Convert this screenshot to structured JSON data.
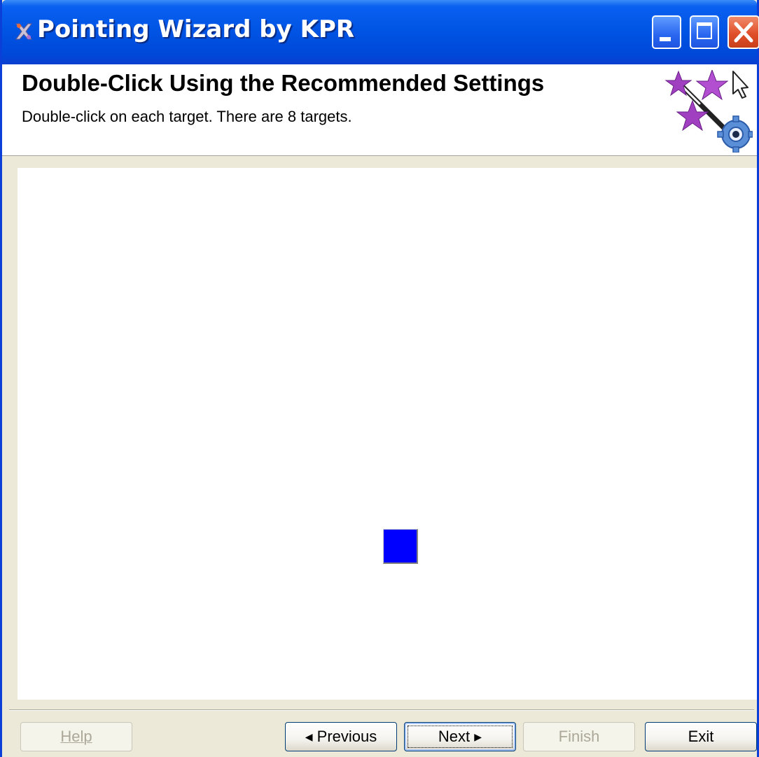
{
  "window": {
    "title": "Pointing Wizard by KPR",
    "icon": "wizard-app-icon"
  },
  "title_buttons": {
    "minimize": "minimize-icon",
    "maximize": "maximize-icon",
    "close": "close-icon"
  },
  "header": {
    "title": "Double-Click Using the Recommended Settings",
    "subtitle": "Double-click on each target. There are 8 targets.",
    "icon": "wizard-stars-gear-icon"
  },
  "target": {
    "color": "#0000ff"
  },
  "buttons": {
    "help": "Help",
    "previous": "Previous",
    "next": "Next",
    "finish": "Finish",
    "exit": "Exit"
  }
}
